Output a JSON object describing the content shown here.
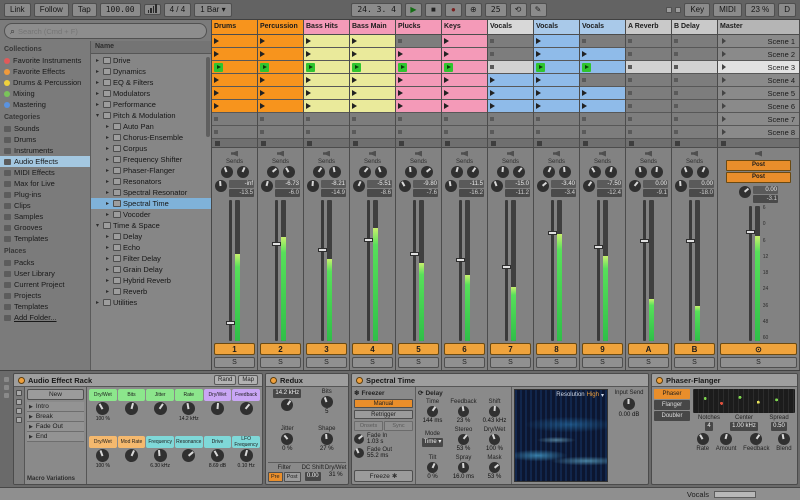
{
  "icons": {
    "play": "▶",
    "stop": "■",
    "record": "●",
    "overdub": "⊕",
    "loop": "⟲",
    "draw": "✎",
    "search": "⌕",
    "caret_down": "▾",
    "caret_right": "▸",
    "freeze": "✱",
    "snowflake": "❄",
    "delay_cycle": "⟳",
    "cue": "⊙"
  },
  "toolbar": {
    "link": "Link",
    "follow": "Follow",
    "tap": "Tap",
    "tempo": "100.00",
    "time_sig": "4 / 4",
    "quantize": "1 Bar",
    "position": "24. 3. 4",
    "loop_length": "25",
    "key": "Key",
    "midi": "MIDI",
    "cpu": "23 %",
    "disk": "D"
  },
  "browser": {
    "search_placeholder": "Search (Cmd + F)",
    "tree_header": "Name",
    "sections": [
      {
        "title": "Collections",
        "items": [
          {
            "label": "Favorite Instruments",
            "dot": "#e05a5a"
          },
          {
            "label": "Favorite Effects",
            "dot": "#f09a3c"
          },
          {
            "label": "Drums & Percussion",
            "dot": "#f0d23c"
          },
          {
            "label": "Mixing",
            "dot": "#7ac45a"
          },
          {
            "label": "Mastering",
            "dot": "#5a93e0"
          }
        ]
      },
      {
        "title": "Categories",
        "items": [
          {
            "label": "Sounds"
          },
          {
            "label": "Drums"
          },
          {
            "label": "Instruments"
          },
          {
            "label": "Audio Effects",
            "selected": true
          },
          {
            "label": "MIDI Effects"
          },
          {
            "label": "Max for Live"
          },
          {
            "label": "Plug-ins"
          },
          {
            "label": "Clips"
          },
          {
            "label": "Samples"
          },
          {
            "label": "Grooves"
          },
          {
            "label": "Templates"
          }
        ]
      },
      {
        "title": "Places",
        "items": [
          {
            "label": "Packs"
          },
          {
            "label": "User Library"
          },
          {
            "label": "Current Project"
          },
          {
            "label": "Projects"
          },
          {
            "label": "Templates"
          },
          {
            "label": "Add Folder...",
            "underline": true
          }
        ]
      }
    ],
    "tree": [
      {
        "label": "Drive",
        "depth": 0
      },
      {
        "label": "Dynamics",
        "depth": 0
      },
      {
        "label": "EQ & Filters",
        "depth": 0
      },
      {
        "label": "Modulators",
        "depth": 0
      },
      {
        "label": "Performance",
        "depth": 0
      },
      {
        "label": "Pitch & Modulation",
        "depth": 0,
        "expanded": true
      },
      {
        "label": "Auto Pan",
        "depth": 1
      },
      {
        "label": "Chorus-Ensemble",
        "depth": 1
      },
      {
        "label": "Corpus",
        "depth": 1
      },
      {
        "label": "Frequency Shifter",
        "depth": 1
      },
      {
        "label": "Phaser-Flanger",
        "depth": 1
      },
      {
        "label": "Resonators",
        "depth": 1
      },
      {
        "label": "Spectral Resonator",
        "depth": 1
      },
      {
        "label": "Spectral Time",
        "depth": 1,
        "selected": true
      },
      {
        "label": "Vocoder",
        "depth": 1
      },
      {
        "label": "Time & Space",
        "depth": 0,
        "expanded": true
      },
      {
        "label": "Delay",
        "depth": 1
      },
      {
        "label": "Echo",
        "depth": 1
      },
      {
        "label": "Filter Delay",
        "depth": 1
      },
      {
        "label": "Grain Delay",
        "depth": 1
      },
      {
        "label": "Hybrid Reverb",
        "depth": 1
      },
      {
        "label": "Reverb",
        "depth": 1
      },
      {
        "label": "Utilities",
        "depth": 0
      }
    ]
  },
  "session": {
    "sends_label": "Sends",
    "solo_label": "S",
    "scene_selected_index": 2,
    "scenes": [
      "Scene 1",
      "Scene 2",
      "Scene 3",
      "Scene 4",
      "Scene 5",
      "Scene 6",
      "Scene 7",
      "Scene 8"
    ],
    "tracks": [
      {
        "name": "Drums",
        "num": "1",
        "header_color": "#f7941d",
        "clip_color": "#f7941d",
        "clips": [
          1,
          1,
          1,
          1,
          1,
          1,
          0,
          0
        ],
        "vol": "-inf",
        "peak": "-13.5",
        "meter": 62,
        "fader": 86
      },
      {
        "name": "Percussion",
        "num": "2",
        "header_color": "#f7941d",
        "clip_color": "#f7941d",
        "clips": [
          1,
          1,
          1,
          1,
          1,
          1,
          0,
          0
        ],
        "vol": "-6.73",
        "peak": "-6.0",
        "meter": 74,
        "fader": 30
      },
      {
        "name": "Bass Hits",
        "num": "3",
        "header_color": "#f49ab8",
        "clip_color": "#eaea9b",
        "clips": [
          1,
          1,
          1,
          1,
          1,
          1,
          0,
          0
        ],
        "vol": "-8.21",
        "peak": "-14.9",
        "meter": 58,
        "fader": 34
      },
      {
        "name": "Bass Main",
        "num": "4",
        "header_color": "#f49ab8",
        "clip_color": "#eaea9b",
        "clips": [
          1,
          1,
          1,
          1,
          1,
          1,
          0,
          0
        ],
        "vol": "-5.51",
        "peak": "-8.6",
        "meter": 80,
        "fader": 27
      },
      {
        "name": "Plucks",
        "num": "5",
        "header_color": "#f49ab8",
        "clip_color": "#f49ab8",
        "clips": [
          0,
          1,
          1,
          1,
          1,
          1,
          0,
          0
        ],
        "vol": "-9.80",
        "peak": "-7.6",
        "meter": 55,
        "fader": 37
      },
      {
        "name": "Keys",
        "num": "6",
        "header_color": "#f49ab8",
        "clip_color": "#f49ab8",
        "clips": [
          1,
          1,
          1,
          1,
          1,
          1,
          0,
          0
        ],
        "vol": "-11.5",
        "peak": "-16.2",
        "meter": 47,
        "fader": 41
      },
      {
        "name": "Vocals",
        "num": "7",
        "header_color": "#d8d8d8",
        "clip_color": "#8fbbe9",
        "clips": [
          0,
          0,
          0,
          1,
          1,
          1,
          0,
          0
        ],
        "vol": "-15.0",
        "peak": "-11.2",
        "meter": 38,
        "fader": 46
      },
      {
        "name": "Vocals",
        "num": "8",
        "header_color": "#a9c9e9",
        "clip_color": "#8fbbe9",
        "clips": [
          1,
          1,
          1,
          1,
          1,
          1,
          0,
          0
        ],
        "vol": "-3.40",
        "peak": "-3.4",
        "meter": 76,
        "fader": 22
      },
      {
        "name": "Vocals",
        "num": "9",
        "header_color": "#a9c9e9",
        "clip_color": "#8fbbe9",
        "clips": [
          0,
          1,
          1,
          0,
          1,
          1,
          0,
          0
        ],
        "vol": "-7.50",
        "peak": "-12.4",
        "meter": 60,
        "fader": 32
      },
      {
        "name": "A Reverb",
        "num": "A",
        "header_color": "#c9c9c9",
        "clip_color": "#c9c9c9",
        "clips": [
          0,
          0,
          0,
          0,
          0,
          0,
          0,
          0
        ],
        "vol": "0.00",
        "peak": "-9.1",
        "meter": 30,
        "fader": 28
      },
      {
        "name": "B Delay",
        "num": "B",
        "header_color": "#c9c9c9",
        "clip_color": "#c9c9c9",
        "clips": [
          0,
          0,
          0,
          0,
          0,
          0,
          0,
          0
        ],
        "vol": "0.00",
        "peak": "-18.0",
        "meter": 25,
        "fader": 28
      }
    ],
    "master": {
      "name": "Master",
      "header_color": "#b5b5b5",
      "vol": "0.00",
      "peak": "-3.1",
      "meter": 78,
      "fader": 18,
      "post_labels": [
        "Post",
        "Post"
      ],
      "scale": [
        "6",
        "0",
        "6",
        "12",
        "18",
        "24",
        "36",
        "48",
        "60"
      ],
      "cue": "⊙"
    }
  },
  "devices": {
    "rack": {
      "title": "Audio Effect Rack",
      "rand": "Rand",
      "map": "Map",
      "variations_new": "New",
      "variations": [
        "Intro",
        "Break",
        "Fade Out",
        "End"
      ],
      "variations_label": "Macro Variations",
      "macros": [
        {
          "label": "Dry/Wet",
          "value": "100 %",
          "color": "#8ce68c"
        },
        {
          "label": "Bits",
          "value": "",
          "color": "#8ce68c"
        },
        {
          "label": "Jitter",
          "value": "",
          "color": "#8ce68c"
        },
        {
          "label": "Rate",
          "value": "14.2 kHz",
          "color": "#8ce68c"
        },
        {
          "label": "Dry/Wet",
          "value": "",
          "color": "#c9a6f5"
        },
        {
          "label": "Feedback",
          "value": "",
          "color": "#c9a6f5"
        },
        {
          "label": "Dry/Wet",
          "value": "100 %",
          "color": "#f5b96e"
        },
        {
          "label": "Mod Rate",
          "value": "",
          "color": "#f5b96e"
        },
        {
          "label": "Frequency",
          "value": "6.30 kHz",
          "color": "#7fd8d8"
        },
        {
          "label": "Resonance",
          "value": "",
          "color": "#7fd8d8"
        },
        {
          "label": "Drive",
          "value": "8.69 dB",
          "color": "#7fd8d8"
        },
        {
          "label": "LFO Frequency",
          "value": "0.10 Hz",
          "color": "#7fd8d8"
        }
      ]
    },
    "redux": {
      "title": "Redux",
      "rate_value": "14.2 kHz",
      "bits_label": "Bits",
      "bits_value": "5",
      "jitter_label": "Jitter",
      "jitter_value": "0 %",
      "shape_label": "Shape",
      "shape_value": "27 %",
      "filter_label": "Filter",
      "pre": "Pre",
      "post": "Post",
      "dc_label": "DC Shift",
      "dc_value": "0.00",
      "drywet_label": "Dry/Wet",
      "drywet_value": "31 %"
    },
    "spectral": {
      "title": "Spectral Time",
      "freezer": {
        "label": "Freezer",
        "manual": "Manual",
        "retrigger": "Retrigger",
        "onsets": "Onsets",
        "sync": "Sync",
        "fade_in_label": "Fade In",
        "fade_in_value": "1.03 s",
        "fade_out_label": "Fade Out",
        "fade_out_value": "55.2 ms",
        "freeze": "Freeze"
      },
      "delay": {
        "label": "Delay",
        "params": [
          {
            "label": "Time",
            "value": "144 ms"
          },
          {
            "label": "Feedback",
            "value": "23 %"
          },
          {
            "label": "Shift",
            "value": "0.43 kHz"
          },
          {
            "label": "Mode",
            "value": "Time",
            "select": true
          },
          {
            "label": "Stereo",
            "value": "53 %"
          },
          {
            "label": "Dry/Wet",
            "value": "100 %"
          },
          {
            "label": "Tilt",
            "value": "0 %"
          },
          {
            "label": "Spray",
            "value": "16.0 ms"
          },
          {
            "label": "Mask",
            "value": "53 %"
          }
        ]
      },
      "resolution_label": "Resolution",
      "resolution_value": "High",
      "input_send_label": "Input Send",
      "input_send_value": "0.00 dB"
    },
    "phaser": {
      "title": "Phaser-Flanger",
      "modes": [
        "Phaser",
        "Flanger",
        "Doubler"
      ],
      "selected_mode": 0,
      "notches_label": "Notches",
      "notches_value": "4",
      "center_label": "Center",
      "center_value": "1.00 kHz",
      "spread_label": "Spread",
      "spread_value": "0.50",
      "knobs": [
        {
          "label": "Rate"
        },
        {
          "label": "Amount"
        },
        {
          "label": "Feedback"
        },
        {
          "label": "Blend"
        }
      ]
    }
  },
  "status_bar": {
    "track": "Vocals"
  }
}
